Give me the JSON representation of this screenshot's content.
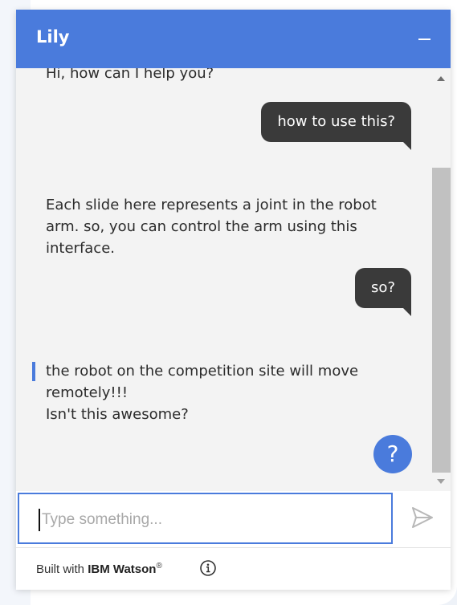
{
  "header": {
    "title": "Lily"
  },
  "messages": [
    {
      "from": "bot",
      "text": "Hi, how can I help you?"
    },
    {
      "from": "user",
      "text": "how to use this?"
    },
    {
      "from": "bot",
      "text": "Each slide here represents a joint in the robot arm. so, you can control the arm using this interface."
    },
    {
      "from": "user",
      "text": "so?"
    },
    {
      "from": "bot",
      "text": "the robot on the competition site will move remotely!!!\nIsn't this awesome?"
    }
  ],
  "help_button": {
    "label": "?"
  },
  "composer": {
    "placeholder": "Type something...",
    "value": ""
  },
  "footer": {
    "prefix": "Built with",
    "brand": "IBM Watson",
    "mark": "®"
  },
  "icons": [
    "minimize-icon",
    "send-icon",
    "info-icon",
    "scroll-up-icon",
    "scroll-down-icon"
  ],
  "colors": {
    "accent": "#4a7bdc",
    "user_bubble": "#3a3a3a",
    "panel": "#f3f3f3"
  }
}
